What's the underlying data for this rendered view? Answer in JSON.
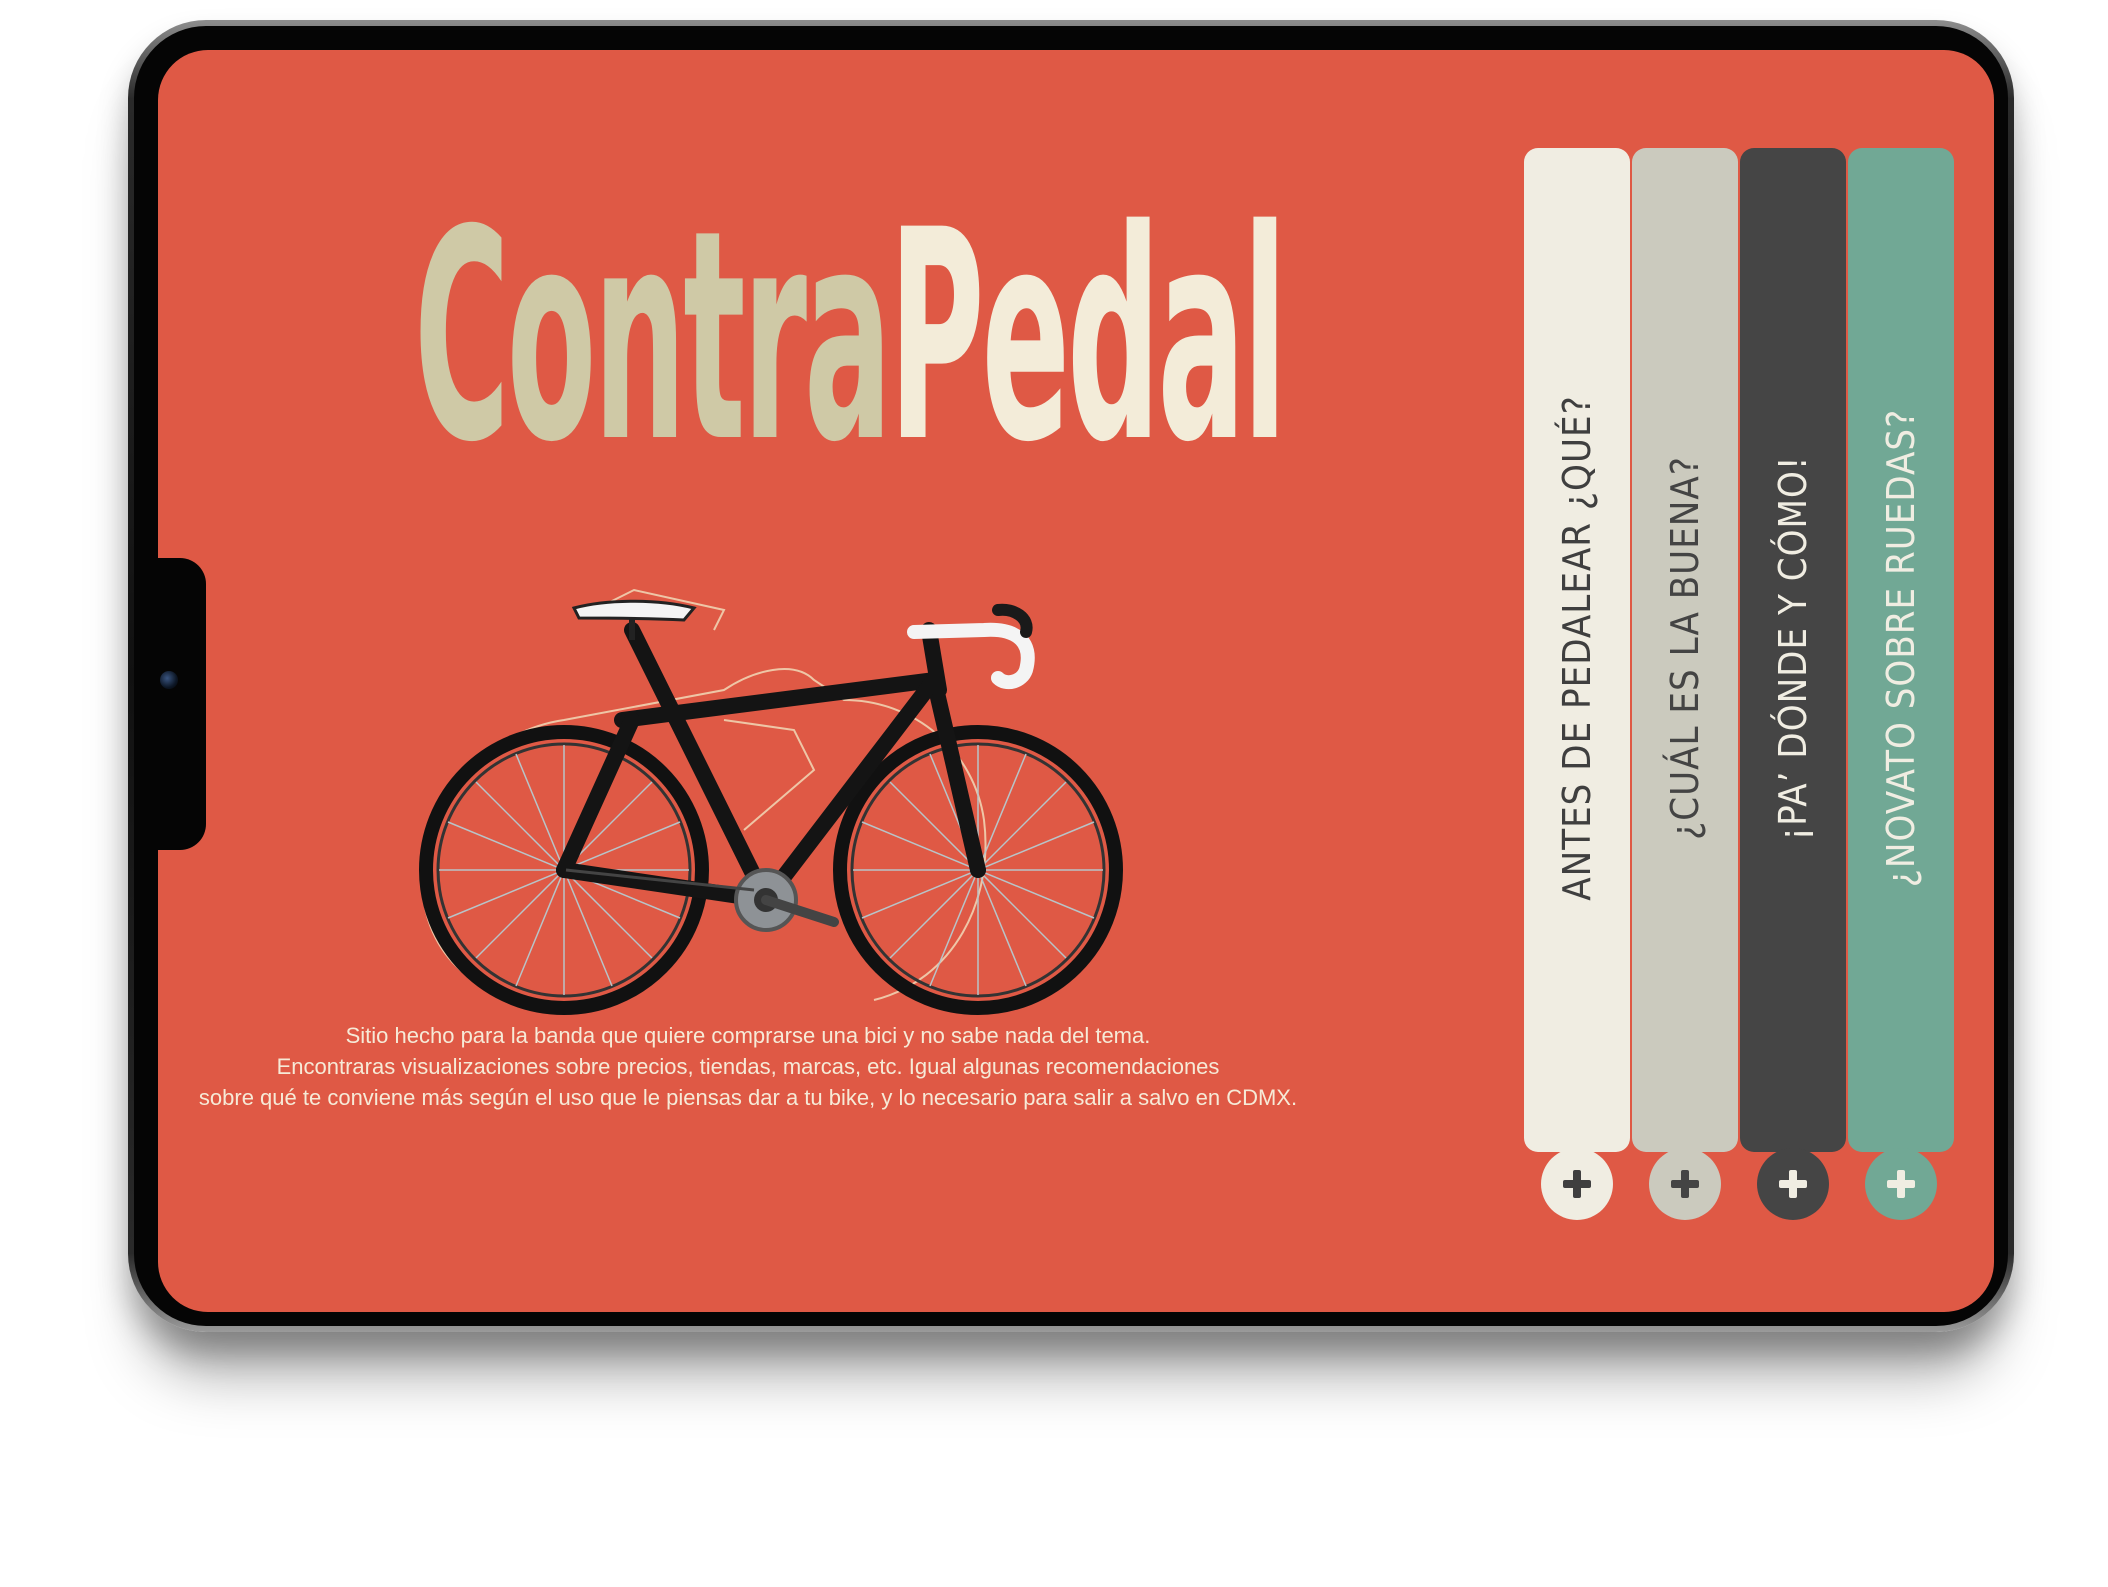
{
  "brand": {
    "part1": "Contra",
    "part2": "Pedal"
  },
  "description": {
    "line1": "Sitio hecho para la banda que quiere comprarse una bici y no sabe nada del tema.",
    "line2": "Encontraras visualizaciones sobre precios, tiendas, marcas, etc. Igual algunas recomendaciones",
    "line3": "sobre qué te conviene más según el uso que le piensas dar a tu bike, y lo necesario para salir a salvo en CDMX."
  },
  "menu": [
    {
      "label": "ANTES DE PEDALEAR ¿QUÉ?",
      "bar_color": "#f0ede2",
      "text_color": "#3f3f3f",
      "button_color": "#f0ede2",
      "plus_color": "#3f3f3f"
    },
    {
      "label": "¿CUÁL ES LA BUENA?",
      "bar_color": "#cbcabe",
      "text_color": "#444444",
      "button_color": "#cbcabe",
      "plus_color": "#444444"
    },
    {
      "label": "¡PA’ DÓNDE Y CÓMO!",
      "bar_color": "#454545",
      "text_color": "#f0ede2",
      "button_color": "#454545",
      "plus_color": "#f0ede2"
    },
    {
      "label": "¿NOVATO SOBRE RUEDAS?",
      "bar_color": "#71a895",
      "text_color": "#f0ede2",
      "button_color": "#71a895",
      "plus_color": "#f0ede2"
    }
  ],
  "colors": {
    "background": "#df5945"
  }
}
